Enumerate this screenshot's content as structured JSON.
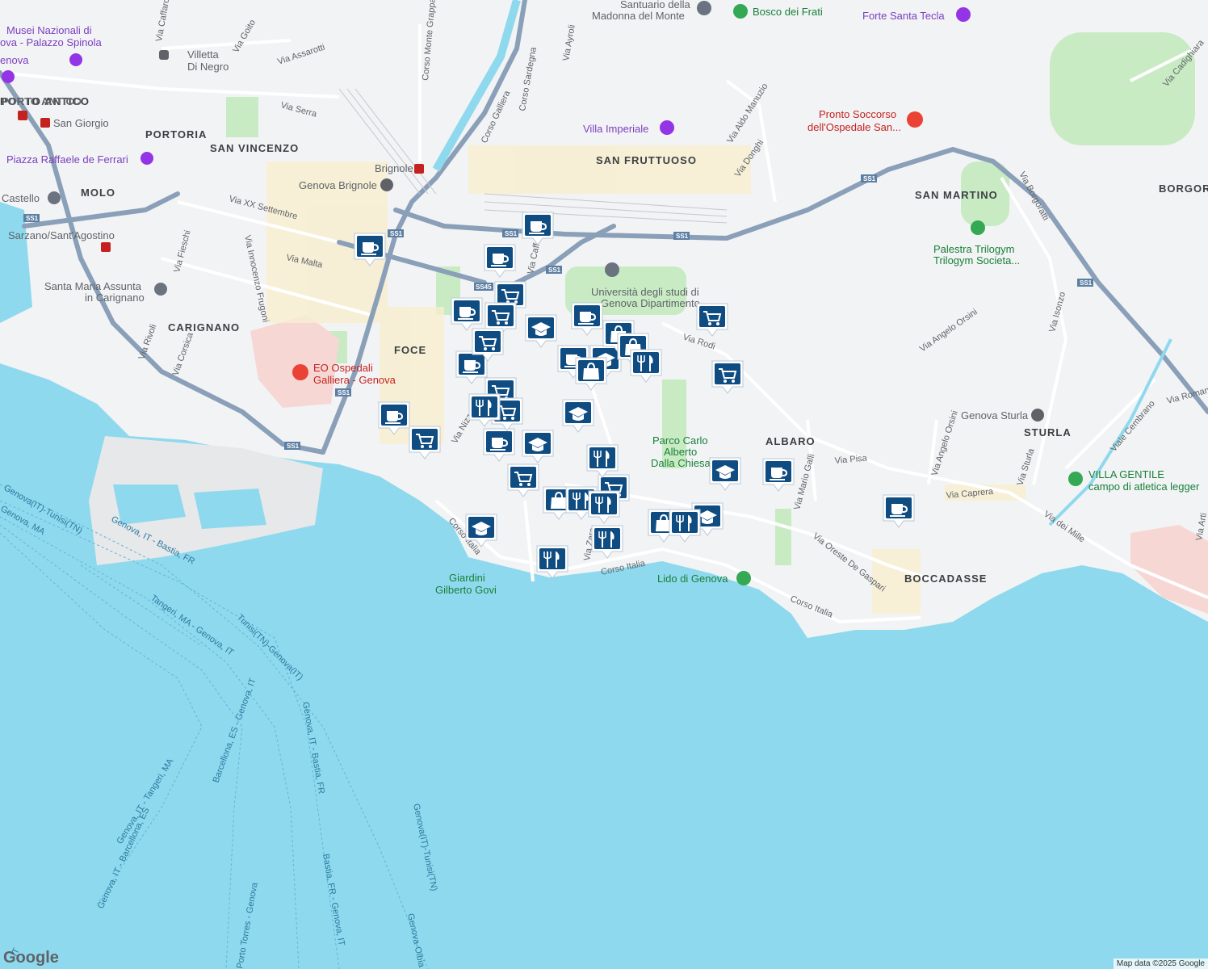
{
  "colors": {
    "water": "#8fd9ee",
    "land": "#f2f3f5",
    "park": "#c9ebc4",
    "highway": "#8a9fb8",
    "road": "#ffffff",
    "marker": "#0f4c81"
  },
  "districts": [
    "SAN FRUTTUOSO",
    "SAN MARTINO",
    "BORGORA",
    "PORTORIA",
    "SAN VINCENZO",
    "MOLO",
    "CARIGNANO",
    "FOCE",
    "ALBARO",
    "STURLA",
    "BOCCADASSE",
    "PORTO ANTICO"
  ],
  "streets": [
    "Via Assarotti",
    "Via Serra",
    "Via XX Settembre",
    "Via Malta",
    "Via Fieschi",
    "Via Innocenzo Frugoni",
    "Via Rivoli",
    "Via Corsica",
    "Corso Sardegna",
    "Corso Galliera",
    "Corso Monte Grappa",
    "Via Goito",
    "Via Ayroli",
    "Via Caffa",
    "Via Caffaro",
    "Via Aldo Manuzio",
    "Via Donghi",
    "Via Borgoratti",
    "Via Cadighiara",
    "Via Rodi",
    "Via Angelo Orsini",
    "Via Isonzo",
    "Via Romana",
    "Viale Cembrano",
    "Via Sturla",
    "Via dei Mille",
    "Via Caprera",
    "Via Pisa",
    "Via Mario Galli",
    "Via Angelo Orsini",
    "Via Oreste De Gaspari",
    "Corso Italia",
    "Corso Italia",
    "Corso Italia",
    "Via Nizza",
    "Via Zara",
    "Via Arti"
  ],
  "places": {
    "musei": "Musei Nazionali di",
    "palazzo": "ova - Palazzo Spinola",
    "genova": "enova",
    "villetta1": "Villetta",
    "villetta2": "Di Negro",
    "porto": "PORTO ANTICO",
    "sangiorgio": "San Giorgio",
    "ferrari": "Piazza Raffaele de Ferrari",
    "castello": "Castello",
    "sarzano": "Sarzano/Sant'Agostino",
    "assunta1": "Santa Maria Assunta",
    "assunta2": "in Carignano",
    "ospedali": "EO Ospedali",
    "galliera": "Galliera - Genova",
    "santuario1": "Santuario della",
    "santuario2": "Madonna del Monte",
    "bosco": "Bosco dei Frati",
    "forte": "Forte Santa Tecla",
    "pronto1": "Pronto Soccorso",
    "pronto2": "dell'Ospedale San...",
    "imperiale": "Villa Imperiale",
    "brignole": "Brignole",
    "genovabrignole": "Genova Brignole",
    "uni1": "Università degli studi di",
    "uni2": "Genova Dipartimento",
    "palestra1": "Palestra Trilogym",
    "palestra2": "Trilogym Societa...",
    "parco1": "Parco Carlo",
    "parco2": "Alberto",
    "parco3": "Dalla Chiesa",
    "sturla": "Genova Sturla",
    "villagentile1": "VILLA GENTILE",
    "villagentile2": "campo di atletica legger",
    "lido": "Lido di Genova",
    "giardini1": "Giardini",
    "giardini2": "Gilberto Govi"
  },
  "shields": [
    "SS1",
    "SS45"
  ],
  "ferries": [
    "Genova(IT)-Tunisi(TN)",
    "Genova, IT - Bastia, FR",
    "Tunisi(TN)-Genova(IT)",
    "Tangeri, MA - Genova, IT",
    "Genova, IT - Bastia, FR",
    "Bastia, FR - Genova, IT",
    "Genova, IT - Tangeri, MA",
    "Barcellona, ES - Genova, IT",
    "Genova, IT - Barcellona, ES",
    "Genova(IT)-Tunisi(TN)",
    "Genova-Olbia",
    "Porto Torres - Genova",
    "Genova, MA",
    "IT"
  ],
  "markers": [
    {
      "t": "cafe"
    },
    {
      "t": "cafe"
    },
    {
      "t": "cafe"
    },
    {
      "t": "cafe"
    },
    {
      "t": "cafe"
    },
    {
      "t": "cafe"
    },
    {
      "t": "cafe"
    },
    {
      "t": "cafe"
    },
    {
      "t": "cafe"
    },
    {
      "t": "cafe"
    },
    {
      "t": "cafe"
    },
    {
      "t": "shop"
    },
    {
      "t": "shop"
    },
    {
      "t": "shop"
    },
    {
      "t": "shop"
    },
    {
      "t": "shop"
    },
    {
      "t": "shop"
    },
    {
      "t": "shop"
    },
    {
      "t": "shop"
    },
    {
      "t": "shop"
    },
    {
      "t": "shop"
    },
    {
      "t": "school"
    },
    {
      "t": "school"
    },
    {
      "t": "school"
    },
    {
      "t": "school"
    },
    {
      "t": "school"
    },
    {
      "t": "school"
    },
    {
      "t": "school"
    },
    {
      "t": "bag"
    },
    {
      "t": "bag"
    },
    {
      "t": "bag"
    },
    {
      "t": "bag"
    },
    {
      "t": "bag"
    },
    {
      "t": "food"
    },
    {
      "t": "food"
    },
    {
      "t": "food"
    },
    {
      "t": "food"
    },
    {
      "t": "food"
    },
    {
      "t": "food"
    },
    {
      "t": "food"
    },
    {
      "t": "food"
    }
  ],
  "footer": {
    "logo": "Google",
    "attribution": "Map data ©2025 Google"
  }
}
